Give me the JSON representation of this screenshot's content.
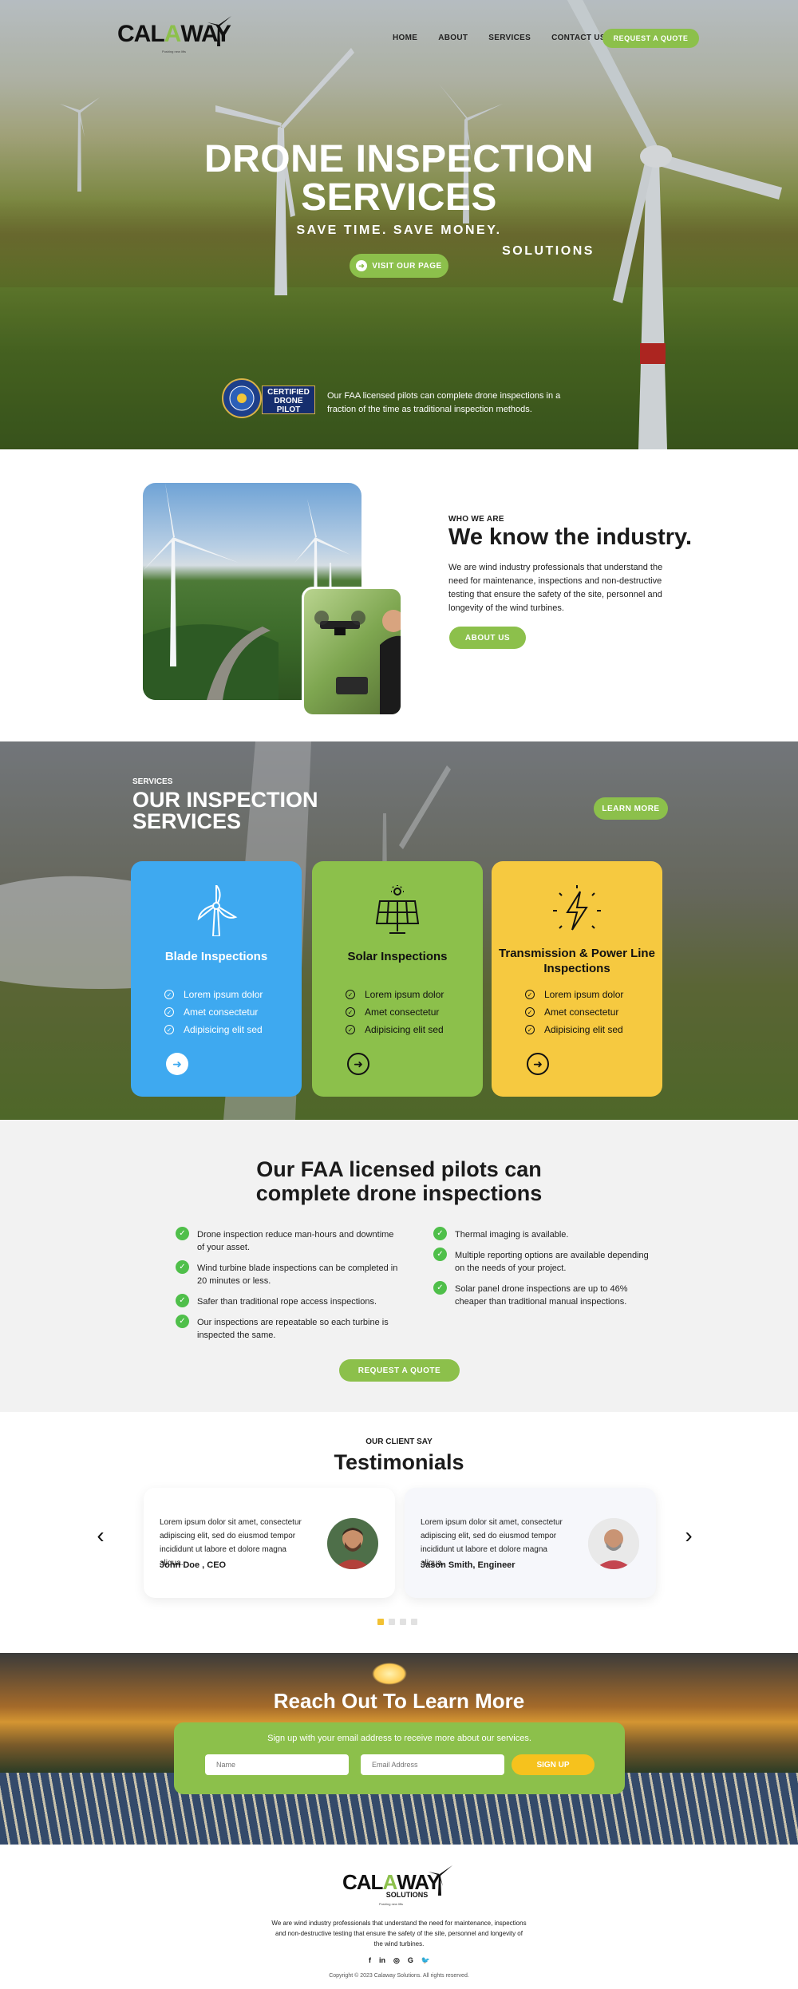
{
  "brand": {
    "name_part1": "CAL",
    "name_accent": "A",
    "name_part2": "WAY",
    "subname": "SOLUTIONS",
    "tagline": "Pushing new lifts"
  },
  "nav": {
    "links": [
      "HOME",
      "ABOUT",
      "SERVICES",
      "CONTACT US"
    ],
    "cta": "REQUEST A QUOTE"
  },
  "hero": {
    "title_line1": "DRONE INSPECTION",
    "title_line2": "SERVICES",
    "subtitle": "SAVE TIME. SAVE MONEY.",
    "button": "VISIT OUR PAGE",
    "badge_line1": "CERTIFIED",
    "badge_line2": "DRONE",
    "badge_line3": "PILOT",
    "note": "Our FAA licensed pilots can complete drone inspections in a fraction of the time as traditional inspection methods."
  },
  "about": {
    "eyebrow": "WHO WE ARE",
    "title": "We know the industry.",
    "text": "We are wind industry professionals that understand the need for maintenance, inspections and non-destructive testing that ensure the safety of the site, personnel and longevity of the wind turbines.",
    "button": "ABOUT US"
  },
  "services": {
    "eyebrow": "SERVICES",
    "title": "OUR INSPECTION SERVICES",
    "button": "LEARN MORE",
    "cards": [
      {
        "title": "Blade Inspections",
        "icon": "wind-turbine-icon",
        "color": "#3ea9f0",
        "items": [
          "Lorem ipsum dolor",
          "Amet consectetur",
          "Adipisicing elit sed"
        ]
      },
      {
        "title": "Solar Inspections",
        "icon": "solar-panel-icon",
        "color": "#8cc04b",
        "items": [
          "Lorem ipsum dolor",
          "Amet consectetur",
          "Adipisicing elit sed"
        ]
      },
      {
        "title": "Transmission & Power Line Inspections",
        "icon": "lightning-icon",
        "color": "#f6c940",
        "items": [
          "Lorem ipsum dolor",
          "Amet consectetur",
          "Adipisicing elit sed"
        ]
      }
    ]
  },
  "faa": {
    "title_line1": "Our FAA licensed pilots can",
    "title_line2": "complete drone inspections",
    "left": [
      "Drone inspection reduce man-hours and downtime of your asset.",
      "Wind turbine blade inspections can be completed in 20 minutes or less.",
      "Safer than traditional rope access inspections.",
      "Our inspections are repeatable so each turbine is inspected the same."
    ],
    "right": [
      "Thermal imaging is available.",
      "Multiple reporting options are available depending on the needs of your project.",
      "Solar panel drone inspections are up to 46% cheaper than traditional manual inspections."
    ],
    "button": "REQUEST A QUOTE"
  },
  "testimonials": {
    "eyebrow": "OUR CLIENT SAY",
    "title": "Testimonials",
    "items": [
      {
        "text": "Lorem ipsum dolor sit amet, consectetur adipiscing elit, sed do eiusmod tempor incididunt ut labore et dolore magna aliqua.",
        "name": "John Doe , CEO"
      },
      {
        "text": "Lorem ipsum dolor sit amet, consectetur adipiscing elit, sed do eiusmod tempor incididunt ut labore et dolore magna aliqua.",
        "name": "Jason Smith, Engineer"
      }
    ],
    "dots": 4,
    "active_dot": 0
  },
  "cta": {
    "title": "Reach Out To Learn More",
    "lead": "Sign up with your email address to receive more about our services.",
    "name_placeholder": "Name",
    "email_placeholder": "Email Address",
    "button": "SIGN UP"
  },
  "footer": {
    "text": "We are wind industry professionals that understand the need for maintenance, inspections and non-destructive testing that ensure the safety of the site, personnel and longevity of the wind turbines.",
    "social": [
      "f",
      "in",
      "◎",
      "G",
      "🐦"
    ],
    "copyright": "Copyright © 2023 Calaway Solutions. All rights reserved."
  }
}
